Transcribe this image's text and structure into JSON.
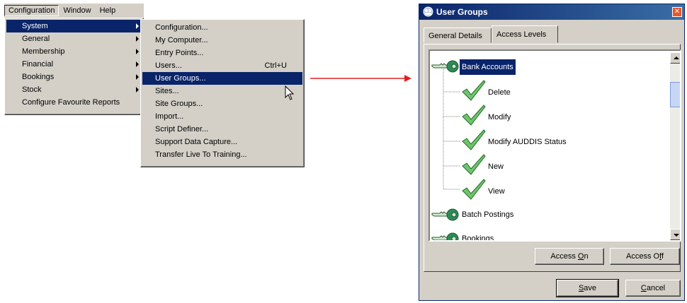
{
  "menubar": {
    "items": [
      {
        "label": "Configuration",
        "active": true
      },
      {
        "label": "Window"
      },
      {
        "label": "Help"
      }
    ]
  },
  "config_menu": {
    "items": [
      {
        "label": "System",
        "submenu": true,
        "selected": true
      },
      {
        "label": "General",
        "submenu": true
      },
      {
        "label": "Membership",
        "submenu": true
      },
      {
        "label": "Financial",
        "submenu": true
      },
      {
        "label": "Bookings",
        "submenu": true
      },
      {
        "label": "Stock",
        "submenu": true
      },
      {
        "label": "Configure Favourite Reports"
      }
    ]
  },
  "system_menu": {
    "items": [
      {
        "label": "Configuration..."
      },
      {
        "label": "My Computer..."
      },
      {
        "label": "Entry Points..."
      },
      {
        "label": "Users...",
        "shortcut": "Ctrl+U"
      },
      {
        "label": "User Groups...",
        "selected": true
      },
      {
        "label": "Sites..."
      },
      {
        "label": "Site Groups..."
      },
      {
        "label": "Import..."
      },
      {
        "label": "Script Definer..."
      },
      {
        "label": "Support Data Capture..."
      },
      {
        "label": "Transfer Live To Training..."
      }
    ]
  },
  "dialog": {
    "title": "User Groups",
    "tabs": [
      {
        "label": "General Details"
      },
      {
        "label": "Access Levels",
        "active": true
      }
    ],
    "tree": [
      {
        "label": "Bank Accounts",
        "level": 0,
        "icon": "key-icon",
        "selected": true
      },
      {
        "label": "Delete",
        "level": 1,
        "icon": "checkmark-icon"
      },
      {
        "label": "Modify",
        "level": 1,
        "icon": "checkmark-icon"
      },
      {
        "label": "Modify AUDDIS Status",
        "level": 1,
        "icon": "checkmark-icon"
      },
      {
        "label": "New",
        "level": 1,
        "icon": "checkmark-icon"
      },
      {
        "label": "View",
        "level": 1,
        "icon": "checkmark-icon"
      },
      {
        "label": "Batch Postings",
        "level": 0,
        "icon": "key-icon"
      },
      {
        "label": "Bookings",
        "level": 0,
        "icon": "key-icon"
      }
    ],
    "access_on": {
      "pre": "Access ",
      "mnemonic": "O",
      "post": "n"
    },
    "access_off": {
      "pre": "Access O",
      "mnemonic": "f",
      "post": "f"
    },
    "save": {
      "pre": "",
      "mnemonic": "S",
      "post": "ave"
    },
    "cancel": {
      "pre": "",
      "mnemonic": "C",
      "post": "ancel"
    }
  },
  "colors": {
    "selection": "#0a246a",
    "face": "#d4d0c8",
    "arrow": "#e02020",
    "check": "#3a9a3a",
    "key": "#2e8b57"
  }
}
